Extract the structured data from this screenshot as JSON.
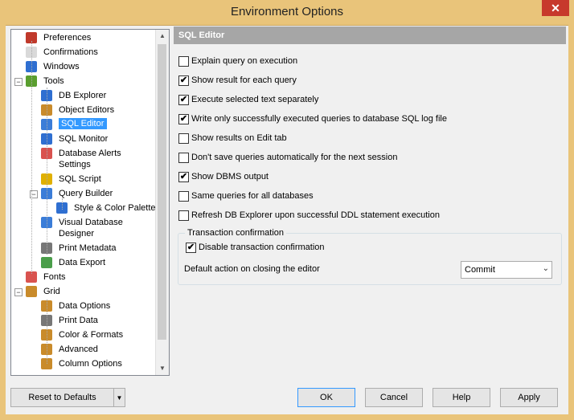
{
  "window": {
    "title": "Environment Options",
    "close_label": "✕"
  },
  "tree": {
    "items": [
      {
        "label": "Preferences",
        "icon": "checklist-icon",
        "color": "#c0392b"
      },
      {
        "label": "Confirmations",
        "icon": "confirm-icon",
        "color": "#d9d9d9"
      },
      {
        "label": "Windows",
        "icon": "windows-icon",
        "color": "#2f6fd1"
      },
      {
        "label": "Tools",
        "icon": "tools-icon",
        "color": "#5a9e2f"
      },
      {
        "label": "DB Explorer",
        "icon": "db-explorer-icon",
        "color": "#2f6fd1"
      },
      {
        "label": "Object Editors",
        "icon": "object-editors-icon",
        "color": "#c98b2b"
      },
      {
        "label": "SQL Editor",
        "icon": "sql-editor-icon",
        "color": "#3b7dd8"
      },
      {
        "label": "SQL Monitor",
        "icon": "sql-monitor-icon",
        "color": "#2f6fd1"
      },
      {
        "label": "Database Alerts",
        "label2": "Settings",
        "icon": "alerts-flag-icon",
        "color": "#d9534f"
      },
      {
        "label": "SQL Script",
        "icon": "sql-script-icon",
        "color": "#e0b000"
      },
      {
        "label": "Query Builder",
        "icon": "query-builder-icon",
        "color": "#3b7dd8"
      },
      {
        "label": "Style & Color Palette",
        "icon": "palette-icon",
        "color": "#2f6fd1"
      },
      {
        "label": "Visual Database",
        "label2": "Designer",
        "icon": "visual-designer-icon",
        "color": "#3b7dd8"
      },
      {
        "label": "Print Metadata",
        "icon": "printer-icon",
        "color": "#777777"
      },
      {
        "label": "Data Export",
        "icon": "data-export-icon",
        "color": "#4a9e4a"
      },
      {
        "label": "Fonts",
        "icon": "fonts-icon",
        "color": "#d9534f"
      },
      {
        "label": "Grid",
        "icon": "grid-icon",
        "color": "#c98b2b"
      },
      {
        "label": "Data Options",
        "icon": "data-options-icon",
        "color": "#c98b2b"
      },
      {
        "label": "Print Data",
        "icon": "print-data-icon",
        "color": "#777777"
      },
      {
        "label": "Color & Formats",
        "icon": "color-formats-icon",
        "color": "#c98b2b"
      },
      {
        "label": "Advanced",
        "icon": "advanced-icon",
        "color": "#c98b2b"
      },
      {
        "label": "Column Options",
        "icon": "column-options-icon",
        "color": "#c98b2b"
      }
    ]
  },
  "panel": {
    "title": "SQL Editor",
    "options": [
      {
        "label": "Explain query on execution",
        "checked": false
      },
      {
        "label": "Show result for each query",
        "checked": true
      },
      {
        "label": "Execute selected text separately",
        "checked": true
      },
      {
        "label": "Write only successfully executed queries to database SQL log file",
        "checked": true
      },
      {
        "label": "Show results on Edit tab",
        "checked": false
      },
      {
        "label": "Don't save queries automatically for the next session",
        "checked": false
      },
      {
        "label": "Show DBMS output",
        "checked": true
      },
      {
        "label": "Same queries for all databases",
        "checked": false
      },
      {
        "label": "Refresh DB Explorer upon successful DDL statement execution",
        "checked": false
      }
    ],
    "transaction": {
      "legend": "Transaction confirmation",
      "disable_label": "Disable transaction confirmation",
      "disable_checked": true,
      "default_action_label": "Default action on closing the editor",
      "default_action_value": "Commit"
    }
  },
  "buttons": {
    "reset": "Reset to Defaults",
    "ok": "OK",
    "cancel": "Cancel",
    "help": "Help",
    "apply": "Apply"
  },
  "colors": {
    "title_bar": "#e9c47a",
    "selection": "#3399ff",
    "panel_header": "#a6a6a6"
  }
}
